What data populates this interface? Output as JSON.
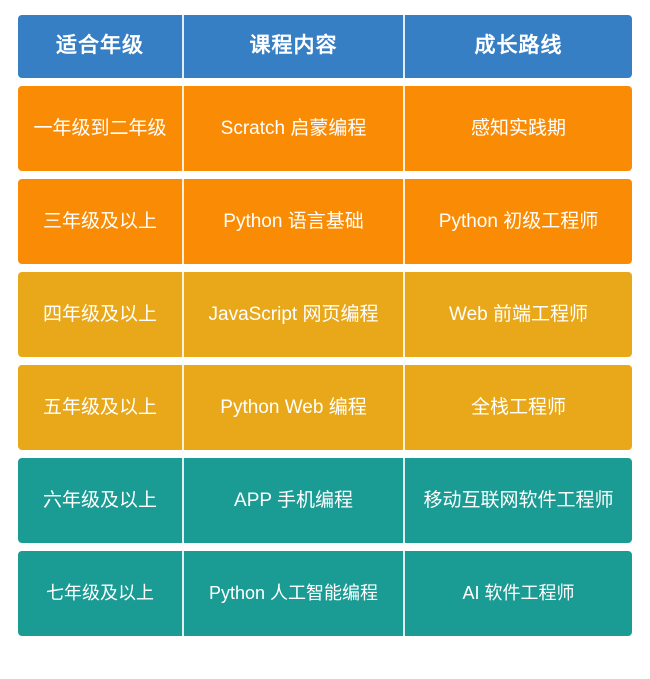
{
  "table": {
    "columns": [
      "适合年级",
      "课程内容",
      "成长路线"
    ],
    "rows": [
      {
        "grade": "一年级到二年级",
        "course": "Scratch 启蒙编程",
        "path": "感知实践期",
        "color": "#fa8c05"
      },
      {
        "grade": "三年级及以上",
        "course": "Python 语言基础",
        "path": "Python 初级工程师",
        "color": "#fa8c05"
      },
      {
        "grade": "四年级及以上",
        "course": "JavaScript 网页编程",
        "path": "Web 前端工程师",
        "color": "#e8a81a"
      },
      {
        "grade": "五年级及以上",
        "course": "Python Web 编程",
        "path": "全栈工程师",
        "color": "#e8a81a"
      },
      {
        "grade": "六年级及以上",
        "course": "APP 手机编程",
        "path": "移动互联网软件工程师",
        "color": "#1a9b93"
      },
      {
        "grade": "七年级及以上",
        "course": "Python 人工智能编程",
        "path": "AI 软件工程师",
        "color": "#1a9b93"
      }
    ],
    "header_color": "#377fc4",
    "text_color": "#ffffff"
  }
}
